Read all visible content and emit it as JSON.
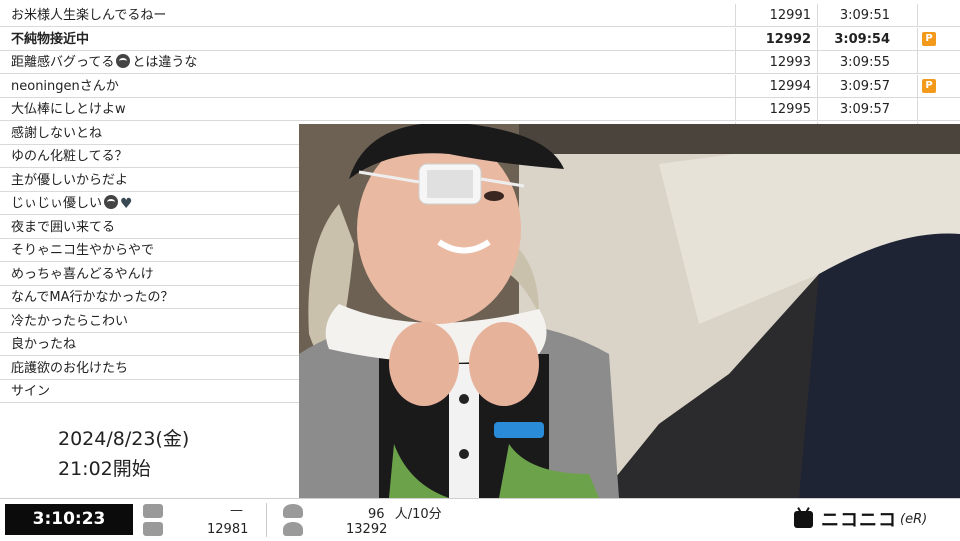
{
  "comments": [
    {
      "text": "お米様人生楽しんでるねー",
      "no": "12991",
      "time": "3:09:51",
      "badge": "",
      "bold": false
    },
    {
      "text": "不純物接近中",
      "no": "12992",
      "time": "3:09:54",
      "badge": "P",
      "bold": true
    },
    {
      "text": "距離感バグってる",
      "text_suffix": "とは違うな",
      "no": "12993",
      "time": "3:09:55",
      "badge": "",
      "bold": false,
      "emoji": "panda-face-icon"
    },
    {
      "text": "neoningenさんか",
      "no": "12994",
      "time": "3:09:57",
      "badge": "P",
      "bold": false
    },
    {
      "text": "大仏棒にしとけよw",
      "no": "12995",
      "time": "3:09:57",
      "badge": "",
      "bold": false
    },
    {
      "text": "感謝しないとね",
      "no": "",
      "time": "",
      "badge": "",
      "bold": false
    },
    {
      "text": "ゆのん化粧してる？",
      "no": "",
      "time": "",
      "badge": "",
      "bold": false
    },
    {
      "text": "主が優しいからだよ",
      "no": "",
      "time": "",
      "badge": "",
      "bold": false
    },
    {
      "text": "じぃじぃ優しい",
      "no": "",
      "time": "",
      "badge": "",
      "bold": false,
      "emoji": "eyes-heart-icon"
    },
    {
      "text": "夜まで囲い来てる",
      "no": "",
      "time": "",
      "badge": "",
      "bold": false
    },
    {
      "text": "そりゃニコ生やからやで",
      "no": "",
      "time": "",
      "badge": "",
      "bold": false
    },
    {
      "text": "めっちゃ喜んどるやんけ",
      "no": "",
      "time": "",
      "badge": "",
      "bold": false
    },
    {
      "text": "なんでMA行かなかったの？",
      "no": "",
      "time": "",
      "badge": "",
      "bold": false
    },
    {
      "text": "冷たかったらこわい",
      "no": "",
      "time": "",
      "badge": "",
      "bold": false
    },
    {
      "text": "良かったね",
      "no": "",
      "time": "",
      "badge": "",
      "bold": false
    },
    {
      "text": "庇護欲のお化けたち",
      "no": "",
      "time": "",
      "badge": "",
      "bold": false
    },
    {
      "text": "サイン",
      "no": "",
      "time": "",
      "badge": "",
      "bold": false
    }
  ],
  "start_info": {
    "date": "2024/8/23(金)",
    "time": "21:02開始"
  },
  "status_bar": {
    "elapsed": "3:10:23",
    "comment_recent": "—",
    "comment_total": "12981",
    "viewer_rate_value": "96",
    "viewer_rate_unit": "人/10分",
    "viewer_total": "13292"
  },
  "logo": {
    "word": "ニコニコ",
    "suffix": "(eR)"
  },
  "colors": {
    "badge_orange": "#f39a1c",
    "elapsed_bg": "#0b0b0b",
    "row_border": "#d9d9d9"
  }
}
